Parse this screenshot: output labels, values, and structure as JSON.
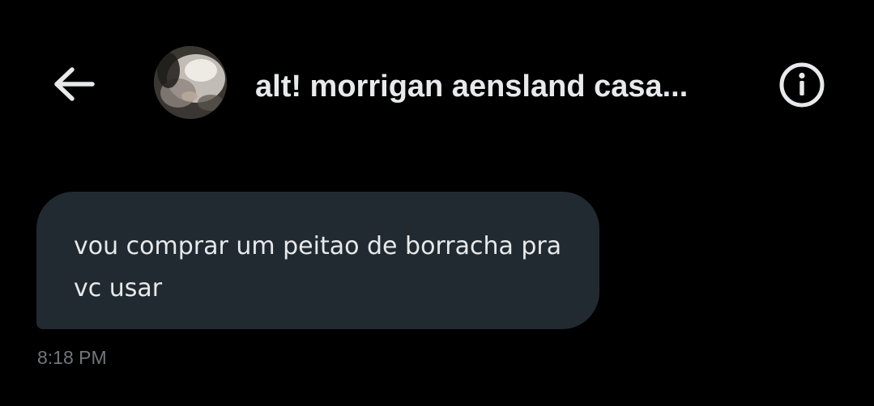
{
  "header": {
    "contact_name": "alt! morrigan aensland casa...",
    "back_icon": "arrow-left-icon",
    "info_icon": "info-circle-icon",
    "avatar_alt": "contact avatar"
  },
  "messages": [
    {
      "text": "vou comprar um peitao de borracha pra vc usar",
      "timestamp": "8:18 PM",
      "direction": "received"
    }
  ],
  "colors": {
    "background": "#000000",
    "bubble_received": "#222a31",
    "text_primary": "#e7e9ea",
    "text_secondary": "#71767b"
  }
}
